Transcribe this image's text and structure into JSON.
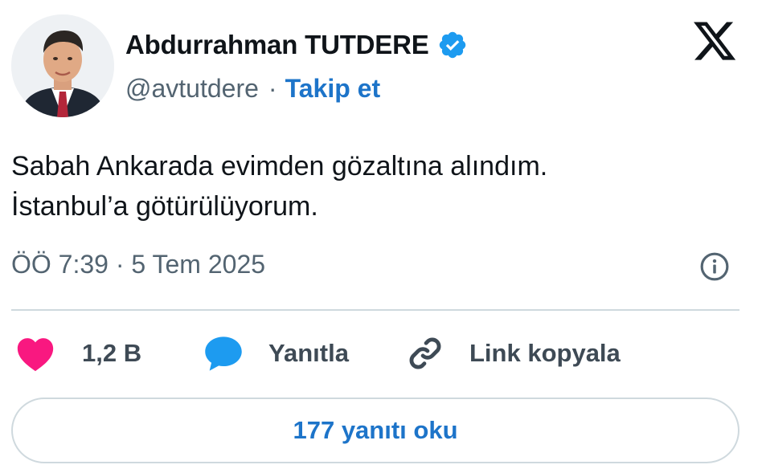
{
  "author": {
    "display_name": "Abdurrahman TUTDERE",
    "handle": "@avtutdere",
    "separator": "·",
    "follow_label": "Takip et",
    "verified": true
  },
  "brand": {
    "logo": "x-logo-icon"
  },
  "tweet": {
    "lines": [
      "Sabah Ankarada evimden gözaltına alındım.",
      "İstanbul’a götürülüyorum."
    ],
    "timestamp": "ÖÖ 7:39 · 5 Tem 2025"
  },
  "actions": {
    "like_count": "1,2 B",
    "reply_label": "Yanıtla",
    "copy_link_label": "Link kopyala"
  },
  "footer": {
    "read_replies_label": "177 yanıtı oku"
  },
  "colors": {
    "link_blue": "#1d74c9",
    "verified_blue": "#1d9bf0",
    "like_pink": "#f91880",
    "reply_blue": "#1d9bf0",
    "muted_text": "#536471",
    "border": "#cfd9de"
  }
}
